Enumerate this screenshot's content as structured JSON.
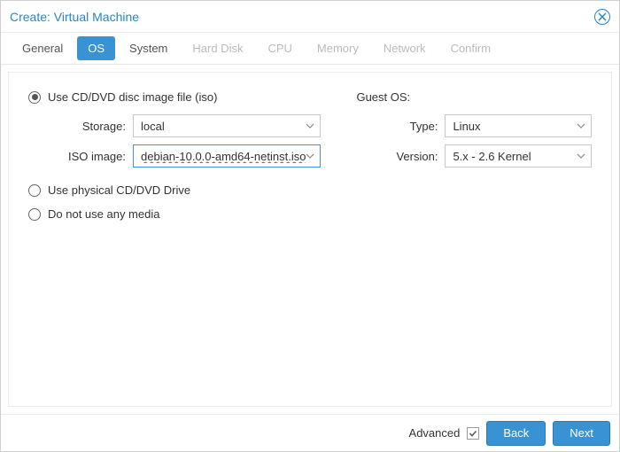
{
  "titlebar": {
    "title": "Create: Virtual Machine"
  },
  "tabs": [
    {
      "label": "General",
      "state": "normal"
    },
    {
      "label": "OS",
      "state": "active"
    },
    {
      "label": "System",
      "state": "normal"
    },
    {
      "label": "Hard Disk",
      "state": "disabled"
    },
    {
      "label": "CPU",
      "state": "disabled"
    },
    {
      "label": "Memory",
      "state": "disabled"
    },
    {
      "label": "Network",
      "state": "disabled"
    },
    {
      "label": "Confirm",
      "state": "disabled"
    }
  ],
  "media": {
    "use_iso_label": "Use CD/DVD disc image file (iso)",
    "storage_label": "Storage:",
    "storage_value": "local",
    "iso_label": "ISO image:",
    "iso_value": "debian-10.0.0-amd64-netinst.iso",
    "use_physical_label": "Use physical CD/DVD Drive",
    "no_media_label": "Do not use any media",
    "selected": "iso"
  },
  "guest": {
    "heading": "Guest OS:",
    "type_label": "Type:",
    "type_value": "Linux",
    "version_label": "Version:",
    "version_value": "5.x - 2.6 Kernel"
  },
  "footer": {
    "advanced_label": "Advanced",
    "advanced_checked": true,
    "back_label": "Back",
    "next_label": "Next"
  }
}
